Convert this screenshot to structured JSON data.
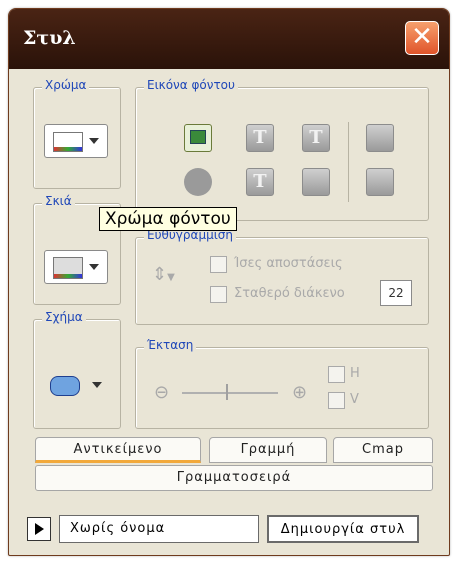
{
  "window": {
    "title": "Στυλ"
  },
  "groups": {
    "color": "Χρώμα",
    "background_image": "Εικόνα φόντου",
    "shadow": "Σκιά",
    "alignment": "Ευθυγράμμιση",
    "shape": "Σχήμα",
    "extent": "Έκταση"
  },
  "tooltip": "Χρώμα φόντου",
  "alignment": {
    "equal_spacing": "Ίσες αποστάσεις",
    "fixed_spacing": "Σταθερό διάκενο",
    "fixed_spacing_value": "22"
  },
  "extent": {
    "h": "H",
    "v": "V"
  },
  "tabs": [
    "Αντικείμενο",
    "Γραμμή",
    "Cmap",
    "Γραμματοσειρά"
  ],
  "bottom": {
    "style_name": "Χωρίς όνομα",
    "create_button": "Δημιουργία στυλ"
  },
  "colors": {
    "title_bar": "#3c1c0f",
    "close": "#e86a3a",
    "legend_text": "#1f47b8",
    "tab_underline": "#f2a93b"
  },
  "icons": [
    "close-icon",
    "image-icon",
    "no-image-icon",
    "text-icon",
    "clear-icon",
    "wrap-icon",
    "fit-icon",
    "crop-icon",
    "arrow-right-icon"
  ]
}
